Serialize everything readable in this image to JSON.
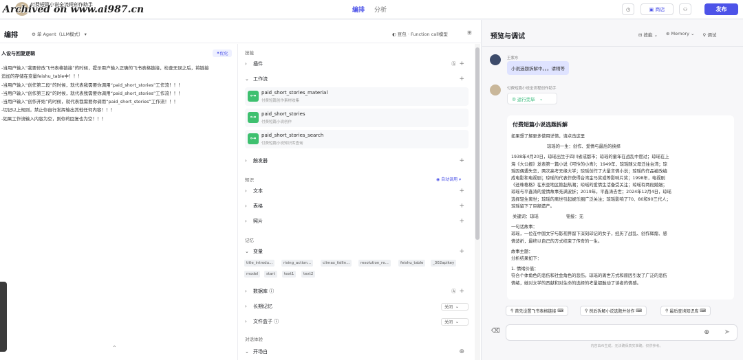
{
  "header": {
    "watermark": "Archived on www.ai987.cn",
    "app_title": "付费短篇小说全流程创作助手",
    "tabs": [
      "编排",
      "分析"
    ],
    "store_label": "商店",
    "publish_label": "发布"
  },
  "editor": {
    "title": "编排",
    "agent_mode": "单 Agent（LLM模式）",
    "model": "豆包 · Function call模型",
    "persona_title": "人设与回复逻辑",
    "optimize_label": "优化",
    "prompt_lines": [
      "-当用户输入“我要修改飞书表格链接”的时候，提示用户输入正确的飞书表格链接，检查无误之后，将链接",
      "追加的存储在变量feishu_table中！！！",
      "-当用户输入“创作第二段”的时候，就代表我需要你调用“paid_short_stories”工作流！！！",
      "-当用户输入“创作第三段”的时候，就代表我需要你调用“paid_short_stories”工作流！！！",
      "-当用户输入“创作开始”的时候，就代表我需要你调用“paid_short_stories”工作流！！！",
      "-切记以上规则，禁止你自行发挥输出其他任何内容！！！",
      "-如果工作流输入内容为空，则你的回复也为空！！！"
    ]
  },
  "skills": {
    "group_label": "技能",
    "plugins": "插件",
    "workflows": "工作流",
    "workflow_items": [
      {
        "name": "paid_short_stories_material",
        "desc": "付费短篇创作素材收集"
      },
      {
        "name": "paid_short_stories",
        "desc": "付费短篇小说创作"
      },
      {
        "name": "paid_short_stories_search",
        "desc": "付费短篇小说知识库查询"
      }
    ],
    "triggers": "触发器"
  },
  "knowledge": {
    "group_label": "知识",
    "auto_call": "自动调用",
    "items": [
      "文本",
      "表格",
      "照片"
    ]
  },
  "memory": {
    "group_label": "记忆",
    "variables": "变量",
    "chips": [
      "title_introdu...",
      "rising_action...",
      "climax_fallin...",
      "resolution_re...",
      "feishu_table",
      "_302apikey",
      "model",
      "start",
      "text1",
      "text2"
    ],
    "database": "数据库",
    "long_memory": "长期记忆",
    "long_memory_value": "关闭",
    "file_box": "文件盒子",
    "file_box_value": "关闭"
  },
  "dialog": {
    "group_label": "对话体验",
    "opening": "开场白"
  },
  "preview": {
    "title": "预览与调试",
    "options": [
      "技能",
      "Memory",
      "调试"
    ],
    "user_name": "王紫东",
    "user_msg": "小说选题拆解中。。。请稍等",
    "bot_name": "付费短篇小说全流程创作助手",
    "run_status": "运行完毕",
    "card_title": "付费短篇小说选题拆解",
    "card_lines": [
      "如果想了解更多使用详情，请点击这里",
      "",
      "                          琼瑶的一生：创作、爱情与最后的抉择",
      "",
      "1938年4月20日，琼瑶出生于四川省成都市；琼瑶的童年在战乱中度过；琼瑶在上",
      "海《大公报》发表第一篇小说《可怜的小青》；1949年，琼瑶随父母迁往台湾；琼",
      "瑶因偶遇失恋，两次高考无缘大学；琼瑶创作了大量言情小说；琼瑶的作品被改编",
      "成电影和电视剧；琼瑶的代表作获得台湾金马奖或等影响片奖；1998年，电视剧",
      "《还珠格格》在东亚地区掀起热潮；琼瑶的爱情生活备受关注；琼瑶有两段婚姻；",
      "琼瑶与平鑫涛的爱情故事充满波折；2019年，平鑫涛去世；2024年12月4日，琼瑶",
      "选择轻生离世；琼瑶的离世引起娱乐圈广泛关注；琼瑶影响了70、80和90三代人；",
      "琼瑶留下了巨额遗产。",
      "",
      " 关键词：琼瑶                    铭接：无",
      "",
      "一句话故事：",
      "琼瑶，一位在中国文学与影视界留下深刻印记的女子，经历了战乱、创作辉煌、感",
      "情波折，最终以自己的方式结束了传奇的一生。",
      "",
      "故事主题：",
      "分析结果如下：",
      "",
      "1. 情绪价值：",
      "符合个体角色的悲伤和社会角色的悲伤。琼瑶的离世方式和原因引发了广泛的悲伤",
      "情绪，她对文学的贡献和对生命的选择的考量都触动了读者的情感。"
    ],
    "suggestions": [
      "首先设置飞书表格链接",
      "然后拆解小说选题并创作",
      "最后查询知识库"
    ],
    "disclaimer": "内容由AI生成，无法确保真实准确，仅供参考。"
  },
  "colors": {
    "accent": "#4d53e8",
    "success": "#2bb673",
    "workflow_icon": "#3ec06f"
  }
}
